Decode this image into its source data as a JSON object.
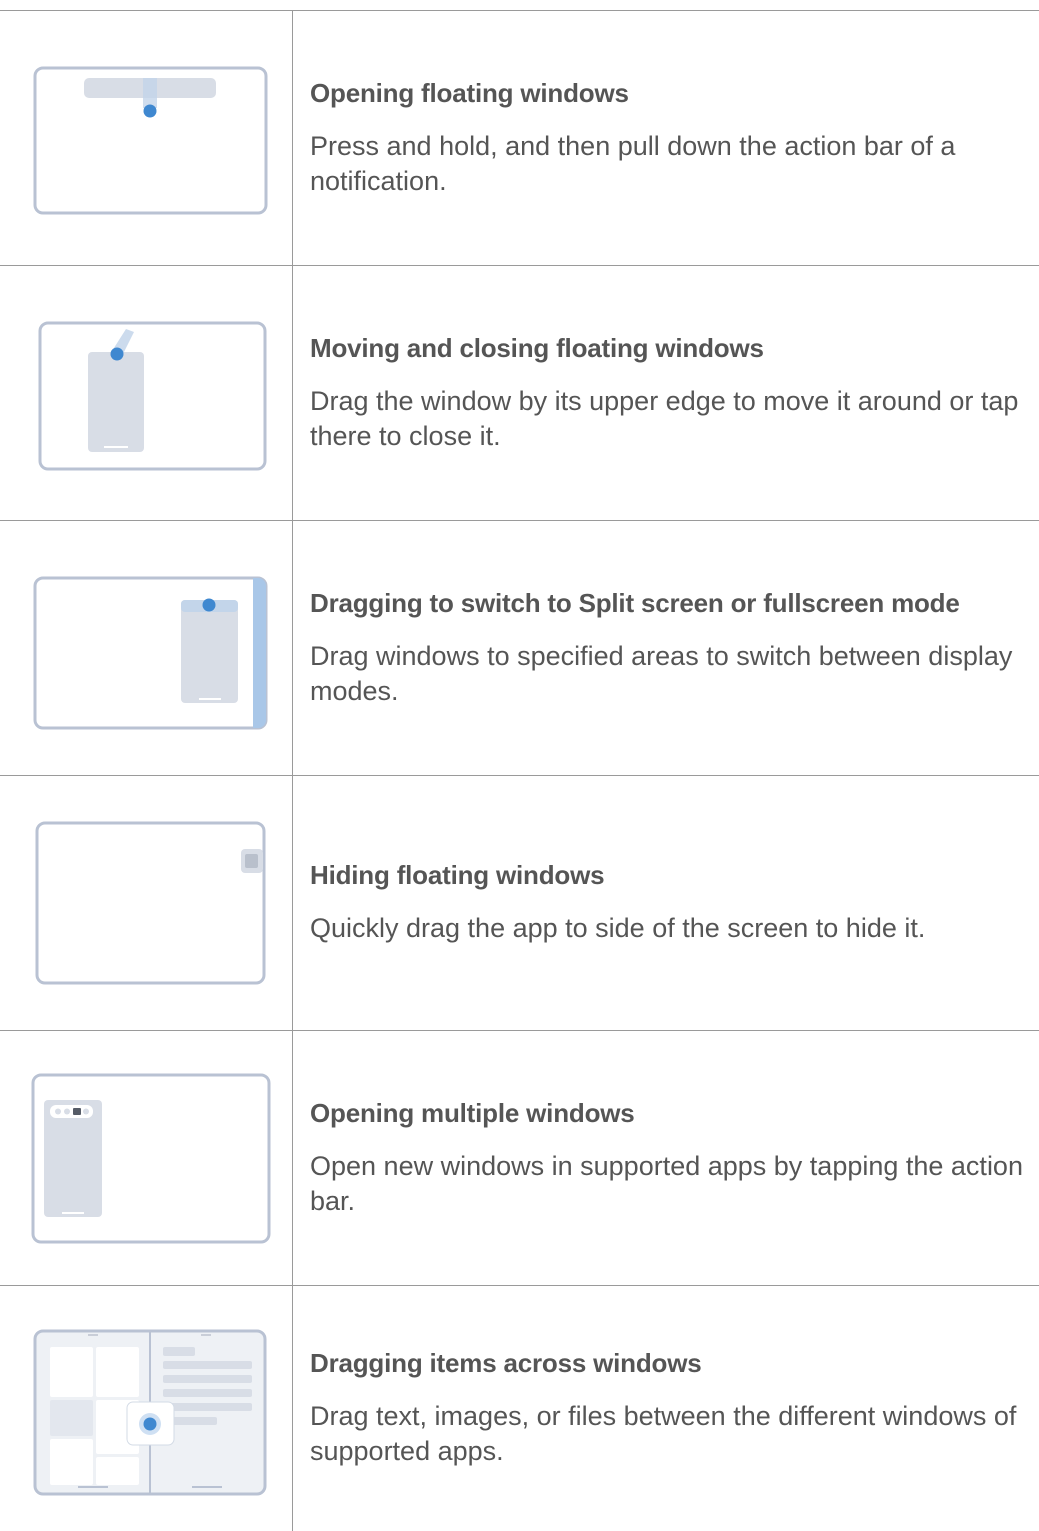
{
  "rows": [
    {
      "title": "Opening floating windows",
      "description": "Press and hold, and then pull down the action bar of a notification.",
      "illustration": "pull-down-notification-icon"
    },
    {
      "title": "Moving and closing floating windows",
      "description": "Drag the window by its upper edge to move it around or tap there to close it.",
      "illustration": "move-floating-window-icon"
    },
    {
      "title": "Dragging to switch to Split screen or fullscreen mode",
      "description": "Drag windows to specified areas to switch between display modes.",
      "illustration": "split-screen-drag-icon"
    },
    {
      "title": "Hiding floating windows",
      "description": "Quickly drag the app to side of the screen to hide it.",
      "illustration": "hide-window-icon"
    },
    {
      "title": "Opening multiple windows",
      "description": "Open new windows in supported apps by tapping the action bar.",
      "illustration": "multiple-windows-icon"
    },
    {
      "title": "Dragging items across windows",
      "description": "Drag text, images, or files between the different windows of supported apps.",
      "illustration": "drag-items-across-windows-icon"
    }
  ],
  "colors": {
    "frame": "#b9c2d3",
    "window": "#d8dde6",
    "accent": "#3f88d0",
    "split_zone": "#a9c7e8"
  }
}
